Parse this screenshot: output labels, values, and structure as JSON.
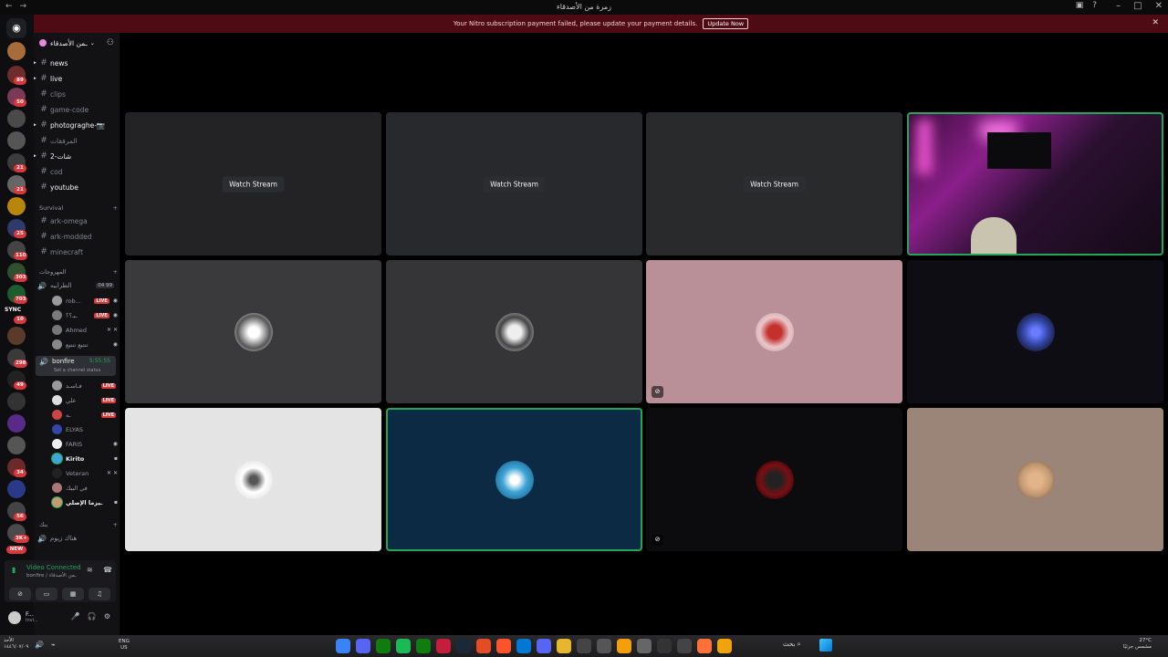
{
  "window": {
    "title": "زمرة من الأصدقاء"
  },
  "banner": {
    "message": "Your Nitro subscription payment failed, please update your payment details.",
    "button": "Update Now"
  },
  "server_rail": {
    "badges": [
      "89",
      "50",
      "21",
      "21",
      "25",
      "110",
      "303",
      "703",
      "10",
      "298",
      "49",
      "34",
      "56",
      "3K+"
    ],
    "new_label": "NEW",
    "sync_label": "SYNC"
  },
  "guild": {
    "name": "ـمن الأصدقاء"
  },
  "channels": [
    {
      "name": "news",
      "bright": true
    },
    {
      "name": "live",
      "bright": true
    },
    {
      "name": "clips",
      "bright": false
    },
    {
      "name": "game-code",
      "bright": false
    },
    {
      "name": "photograghe-📷",
      "bright": true
    },
    {
      "name": "المرفقات",
      "bright": false
    },
    {
      "name": "شات-2",
      "bright": true
    },
    {
      "name": "cod",
      "bright": false
    },
    {
      "name": "youtube",
      "bright": true
    }
  ],
  "categories": {
    "survival": "Survival",
    "arabic": "المهروجات",
    "last": "بنك"
  },
  "survival_channels": [
    "ark-omega",
    "ark-modded",
    "minecraft"
  ],
  "voice_channels": {
    "first": {
      "name": "الطرابيه",
      "count": "04 99"
    },
    "first_users": [
      {
        "name": "rob...",
        "live": "LIVE"
      },
      {
        "name": "ـبـ؟؟",
        "live": "LIVE"
      },
      {
        "name": "Ahmed",
        "live": ""
      },
      {
        "name": "تنتيع تنتيع",
        "live": ""
      }
    ],
    "bonfire": {
      "name": "bonfire",
      "timer": "5:55:55",
      "status": "Set a channel status"
    },
    "bonfire_users": [
      {
        "name": "فـاسـد",
        "live": "LIVE",
        "bright": false
      },
      {
        "name": "علي",
        "live": "LIVE",
        "bright": false
      },
      {
        "name": "ـه",
        "live": "LIVE",
        "bright": false
      },
      {
        "name": "ELYAS",
        "live": "",
        "bright": false
      },
      {
        "name": "FARIS",
        "live": "",
        "bright": false
      },
      {
        "name": "Kirito",
        "live": "",
        "bright": true
      },
      {
        "name": "Veteran",
        "live": "",
        "bright": false
      },
      {
        "name": "في البيك",
        "live": "",
        "bright": false
      },
      {
        "name": "ـيزما الإصلي",
        "live": "",
        "bright": true
      }
    ],
    "last": {
      "name": "هناك زيوم"
    }
  },
  "voice_panel": {
    "status": "Video Connected",
    "location": "bonfire / ـمن الأصدقاء"
  },
  "user": {
    "name": "F...",
    "sub": "Invi..."
  },
  "stage": {
    "watch_label": "Watch Stream"
  },
  "tiles": [
    {
      "kind": "stream",
      "label": "Watch Stream",
      "bg": "#232326"
    },
    {
      "kind": "stream",
      "label": "Watch Stream",
      "bg": "#27292c"
    },
    {
      "kind": "stream",
      "label": "Watch Stream",
      "bg": "#282a2c"
    },
    {
      "kind": "camera",
      "bg": "#1a1020"
    },
    {
      "kind": "avatar",
      "bg": "#3a3a3c",
      "avatar": "#d8d8d8"
    },
    {
      "kind": "avatar",
      "bg": "#353537",
      "avatar": "#cfcfcf"
    },
    {
      "kind": "avatar",
      "bg": "#b98f98",
      "avatar": "#c4302b"
    },
    {
      "kind": "avatar",
      "bg": "#0d0d13",
      "avatar": "#3447a8"
    },
    {
      "kind": "avatar",
      "bg": "#e4e4e4",
      "avatar": "#f7f7f7"
    },
    {
      "kind": "avatar",
      "bg": "#0c2a44",
      "avatar": "#3ea5d6"
    },
    {
      "kind": "avatar",
      "bg": "#0c0c0e",
      "avatar": "#7a0f12"
    },
    {
      "kind": "avatar",
      "bg": "#9b8478",
      "avatar": "#c49a72"
    }
  ],
  "taskbar": {
    "date": "الأحد",
    "date_sub": "١٤٤٦/٠٧/٠٩",
    "lang": "ENG",
    "lang_sub": "US",
    "search": "بحث",
    "temp": "27°C",
    "weather": "مشمس جزئيًا"
  }
}
